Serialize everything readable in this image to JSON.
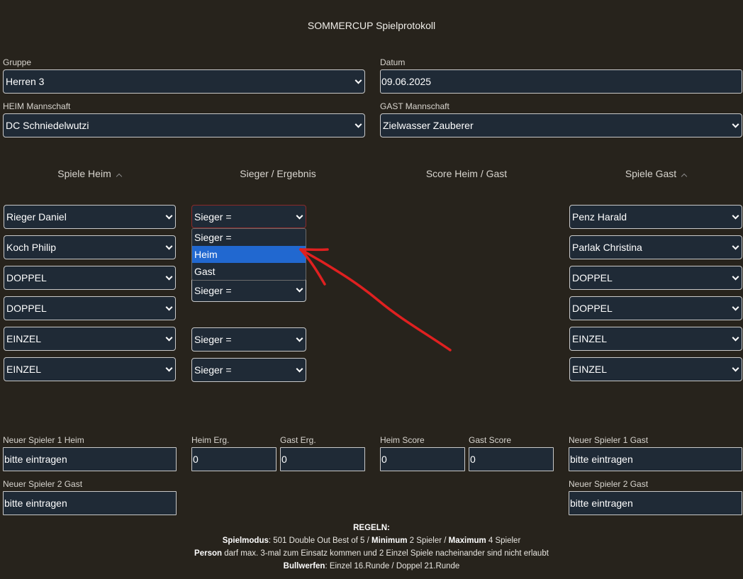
{
  "title": "SOMMERCUP Spielprotokoll",
  "group": {
    "label": "Gruppe",
    "value": "Herren 3"
  },
  "date": {
    "label": "Datum",
    "value": "09.06.2025"
  },
  "home_team": {
    "label": "HEIM Mannschaft",
    "value": "DC Schniedelwutzi"
  },
  "away_team": {
    "label": "GAST Mannschaft",
    "value": "Zielwasser Zauberer"
  },
  "columns": {
    "home_games": "Spiele Heim",
    "winner_result": "Sieger / Ergebnis",
    "score": "Score Heim / Gast",
    "away_games": "Spiele Gast"
  },
  "home_players": [
    "Rieger Daniel",
    "Koch Philip",
    "DOPPEL",
    "DOPPEL",
    "EINZEL",
    "EINZEL"
  ],
  "away_players": [
    "Penz Harald",
    "Parlak Christina",
    "DOPPEL",
    "DOPPEL",
    "EINZEL",
    "EINZEL"
  ],
  "winners": [
    "Sieger =",
    "Sieger =",
    "Sieger =",
    "Sieger ="
  ],
  "dropdown": {
    "options": [
      "Sieger =",
      "Heim",
      "Gast"
    ],
    "highlighted": "Heim"
  },
  "new_player_1_home": {
    "label": "Neuer Spieler 1 Heim",
    "value": "bitte eintragen"
  },
  "new_player_2_home": {
    "label": "Neuer Spieler 2 Gast",
    "value": "bitte eintragen"
  },
  "new_player_1_away": {
    "label": "Neuer Spieler 1 Gast",
    "value": "bitte eintragen"
  },
  "new_player_2_away": {
    "label": "Neuer Spieler 2 Gast",
    "value": "bitte eintragen"
  },
  "home_result": {
    "label": "Heim Erg.",
    "value": "0"
  },
  "away_result": {
    "label": "Gast Erg.",
    "value": "0"
  },
  "home_score": {
    "label": "Heim Score",
    "value": "0"
  },
  "away_score": {
    "label": "Gast Score",
    "value": "0"
  },
  "rules": {
    "heading": "REGELN:",
    "mode_key": "Spielmodus",
    "mode_text1": ": 501 Double Out Best of 5 / ",
    "min_key": "Minimum",
    "min_text": " 2 Spieler / ",
    "max_key": "Maximum",
    "max_text": " 4 Spieler",
    "person_key": "Person",
    "person_text": " darf max. 3-mal zum Einsatz kommen und 2 Einzel Spiele nacheinander sind nicht erlaubt",
    "bull_key": "Bullwerfen",
    "bull_text": ": Einzel 16.Runde / Doppel 21.Runde"
  },
  "annotation_color": "#e02020"
}
